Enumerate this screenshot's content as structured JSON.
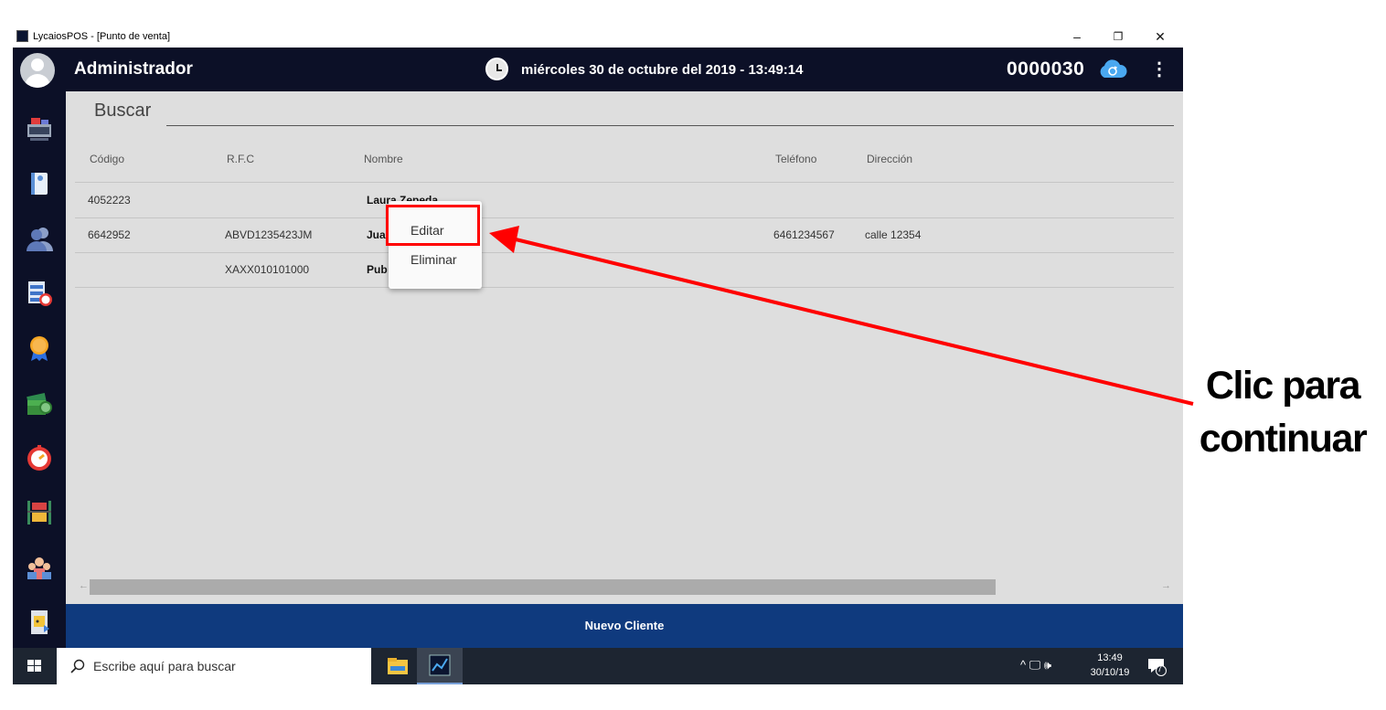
{
  "window": {
    "title": "LycaiosPOS - [Punto de venta]",
    "minimize_glyph": "–",
    "restore_glyph": "❐",
    "close_glyph": "✕"
  },
  "header": {
    "user_name": "Administrador",
    "datetime": "miércoles 30 de octubre del 2019 - 13:49:14",
    "ticket_number": "0000030",
    "menu_glyph": "⋮"
  },
  "sidebar": {
    "items": [
      {
        "icon": "cash-register-icon"
      },
      {
        "icon": "notebook-icon"
      },
      {
        "icon": "customers-icon"
      },
      {
        "icon": "reports-clock-icon"
      },
      {
        "icon": "top-badge-icon"
      },
      {
        "icon": "money-icon"
      },
      {
        "icon": "stopwatch-icon"
      },
      {
        "icon": "inventory-box-icon"
      },
      {
        "icon": "users-group-icon"
      },
      {
        "icon": "exit-icon"
      }
    ]
  },
  "search": {
    "label": "Buscar"
  },
  "table": {
    "columns": [
      "Código",
      "R.F.C",
      "Nombre",
      "Teléfono",
      "Dirección"
    ],
    "rows": [
      {
        "codigo": "4052223",
        "rfc": "",
        "nombre": "Laura Zepeda",
        "telefono": "",
        "direccion": ""
      },
      {
        "codigo": "6642952",
        "rfc": "ABVD1235423JM",
        "nombre": "Jua",
        "telefono": "6461234567",
        "direccion": "calle 12354"
      },
      {
        "codigo": "",
        "rfc": "XAXX010101000",
        "nombre": "Pub",
        "telefono": "",
        "direccion": ""
      }
    ]
  },
  "scrollbar": {
    "left_glyph": "←",
    "right_glyph": "→"
  },
  "context_menu": {
    "edit_label": "Editar",
    "delete_label": "Eliminar"
  },
  "footer": {
    "new_client_label": "Nuevo Cliente"
  },
  "taskbar": {
    "search_placeholder": "Escribe aquí para buscar",
    "tray_glyphs": "^ 🖵 🕪",
    "time": "13:49",
    "date": "30/10/19",
    "notification_count": "7"
  },
  "annotation": {
    "line1": "Clic para",
    "line2": "continuar"
  },
  "colors": {
    "header_bg": "#0c1027",
    "content_bg": "#dedede",
    "footer_bg": "#0f3a7e",
    "highlight": "#ff0000"
  }
}
